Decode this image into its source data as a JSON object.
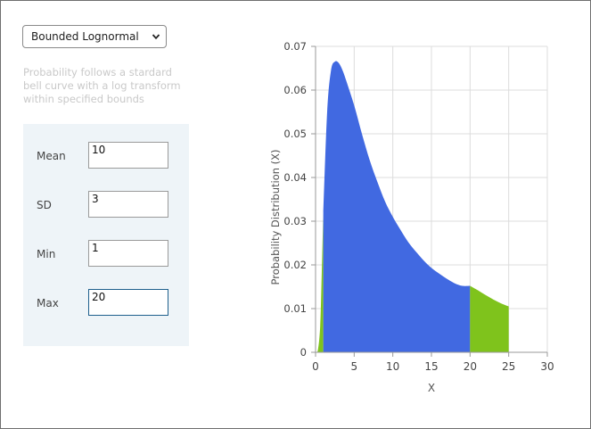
{
  "distribution_select": {
    "selected": "Bounded Lognormal",
    "icon": "chevron-down-icon"
  },
  "description": "Probability follows a stardard bell curve with a log transform within specified bounds",
  "params": [
    {
      "key": "mean",
      "label": "Mean",
      "value": "10"
    },
    {
      "key": "sd",
      "label": "SD",
      "value": "3"
    },
    {
      "key": "min",
      "label": "Min",
      "value": "1"
    },
    {
      "key": "max",
      "label": "Max",
      "value": "20"
    }
  ],
  "colors": {
    "in_bounds": "#4169e1",
    "out_of_bounds": "#7fc31c",
    "grid": "#dcdcdc",
    "axis": "#999999"
  },
  "chart_data": {
    "type": "area",
    "title": "",
    "xlabel": "X",
    "ylabel": "Probability Distribution (X)",
    "xlim": [
      0,
      30
    ],
    "ylim": [
      0,
      0.07
    ],
    "x_ticks": [
      "0",
      "5",
      "10",
      "15",
      "20",
      "25",
      "30"
    ],
    "y_ticks": [
      "0",
      "0.01",
      "0.02",
      "0.03",
      "0.04",
      "0.05",
      "0.06",
      "0.07"
    ],
    "grid": true,
    "series": [
      {
        "role": "out-of-bounds-low",
        "color": "#7fc31c",
        "x": [
          0,
          0.3,
          0.6,
          0.8,
          1.0
        ],
        "y": [
          0,
          0.0005,
          0.006,
          0.018,
          0.032
        ]
      },
      {
        "role": "in-bounds",
        "color": "#4169e1",
        "x": [
          1,
          1.5,
          2,
          2.5,
          3,
          3.5,
          4,
          5,
          6,
          7,
          8,
          9,
          10,
          11,
          12,
          13,
          14,
          15,
          16,
          17,
          18,
          19,
          20
        ],
        "y": [
          0.032,
          0.055,
          0.0645,
          0.0665,
          0.0662,
          0.0645,
          0.062,
          0.0565,
          0.05,
          0.044,
          0.039,
          0.0345,
          0.031,
          0.028,
          0.0252,
          0.023,
          0.021,
          0.0193,
          0.018,
          0.0168,
          0.0158,
          0.0152,
          0.0152
        ]
      },
      {
        "role": "out-of-bounds-high",
        "color": "#7fc31c",
        "x": [
          20,
          21,
          22,
          23,
          24,
          25
        ],
        "y": [
          0.0152,
          0.0142,
          0.0131,
          0.0121,
          0.0112,
          0.0105
        ]
      }
    ]
  }
}
